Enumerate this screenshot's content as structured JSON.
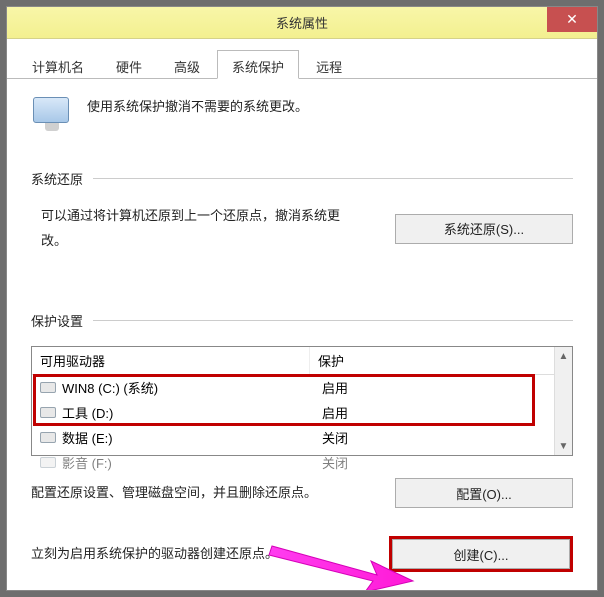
{
  "window": {
    "title": "系统属性"
  },
  "tabs": {
    "computer_name": "计算机名",
    "hardware": "硬件",
    "advanced": "高级",
    "system_protection": "系统保护",
    "remote": "远程"
  },
  "intro": "使用系统保护撤消不需要的系统更改。",
  "sections": {
    "restore": {
      "title": "系统还原",
      "desc": "可以通过将计算机还原到上一个还原点，撤消系统更改。",
      "button": "系统还原(S)..."
    },
    "settings": {
      "title": "保护设置",
      "col_drive": "可用驱动器",
      "col_protect": "保护",
      "rows": [
        {
          "name": "WIN8 (C:) (系统)",
          "prot": "启用"
        },
        {
          "name": "工具 (D:)",
          "prot": "启用"
        },
        {
          "name": "数据 (E:)",
          "prot": "关闭"
        },
        {
          "name": "影音 (F:)",
          "prot": "关闭"
        }
      ],
      "configure_desc": "配置还原设置、管理磁盘空间，并且删除还原点。",
      "configure_btn": "配置(O)...",
      "create_desc": "立刻为启用系统保护的驱动器创建还原点。",
      "create_btn": "创建(C)..."
    }
  }
}
